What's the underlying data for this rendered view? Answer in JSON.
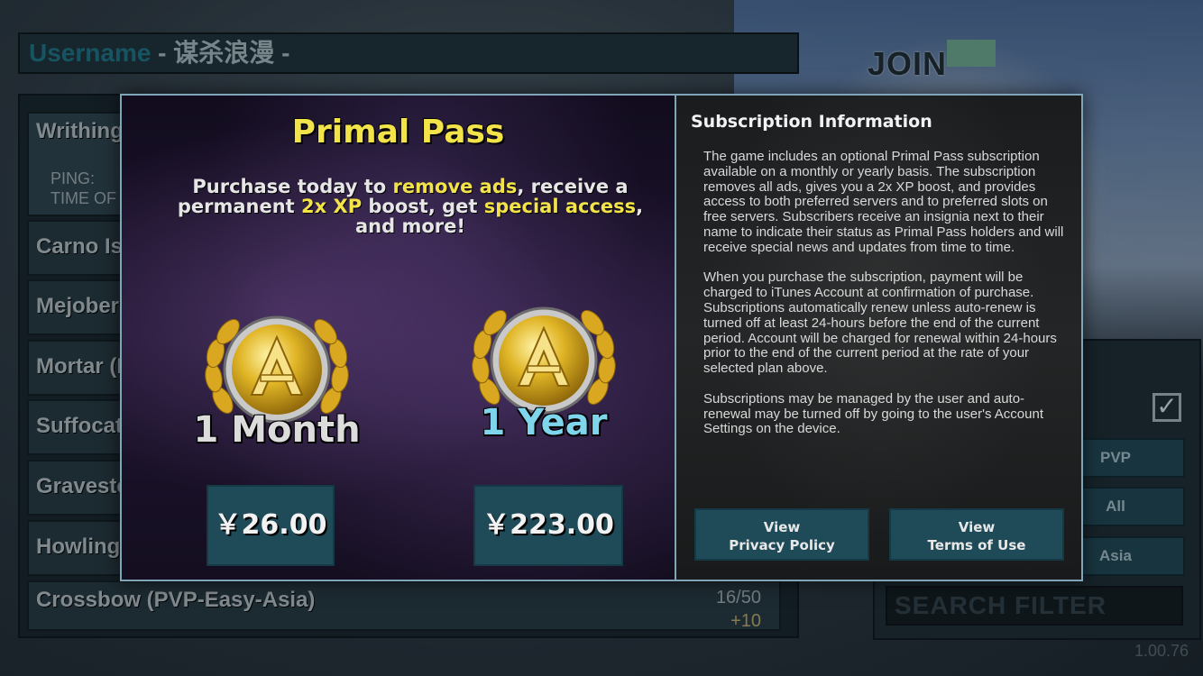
{
  "background": {
    "username_label": "Username",
    "username_value": " - 谋杀浪漫 -",
    "join_label": "JOIN",
    "servers": [
      {
        "name": "Writhing",
        "ping_label": "PING:",
        "time_label": "TIME OF"
      },
      {
        "name": "Carno Is"
      },
      {
        "name": "Mejober"
      },
      {
        "name": "Mortar (I"
      },
      {
        "name": "Suffocat"
      },
      {
        "name": "Gravesto"
      },
      {
        "name": "Howling"
      },
      {
        "name": "Crossbow (PVP-Easy-Asia)",
        "players": "16/50",
        "bonus": "+10"
      }
    ],
    "filters": {
      "mode": "PVP",
      "difficulty": "All",
      "region": "Asia",
      "search_placeholder": "SEARCH FILTER"
    },
    "version": "1.00.76"
  },
  "modal": {
    "title": "Primal Pass",
    "description": {
      "part1": "Purchase today to ",
      "hl1": "remove ads",
      "part2": ", receive a permanent ",
      "hl2": "2x XP",
      "part3": " boost, get ",
      "hl3": "special access",
      "part4": ", and more!"
    },
    "plans": [
      {
        "label": "1 Month",
        "price": "￥26.00"
      },
      {
        "label": "1 Year",
        "price": "￥223.00"
      }
    ],
    "info": {
      "title": "Subscription Information",
      "paragraphs": [
        "The game includes an optional Primal Pass subscription available on a monthly or yearly basis. The subscription removes all ads, gives you a 2x XP boost, and provides access to both preferred servers and to preferred slots on free servers. Subscribers receive an insignia next to their name to indicate their status as Primal Pass holders and will receive special news and updates from time to time.",
        "When you purchase the subscription, payment will be charged to iTunes Account at confirmation of purchase. Subscriptions automatically renew unless auto-renew is turned off at least 24-hours before the end of the current period. Account will be charged for renewal within 24-hours prior to the end of the current period at the rate of your selected plan above.",
        "Subscriptions may be managed by the user and auto-renewal may be turned off by going to the user's Account Settings on the device."
      ],
      "privacy_line1": "View",
      "privacy_line2": "Privacy Policy",
      "terms_line1": "View",
      "terms_line2": "Terms of Use"
    }
  },
  "colors": {
    "accent_yellow": "#f3e34a",
    "year_cyan": "#7fd6ec",
    "button_teal": "#1f4a58",
    "modal_border": "#7fa6b8"
  }
}
